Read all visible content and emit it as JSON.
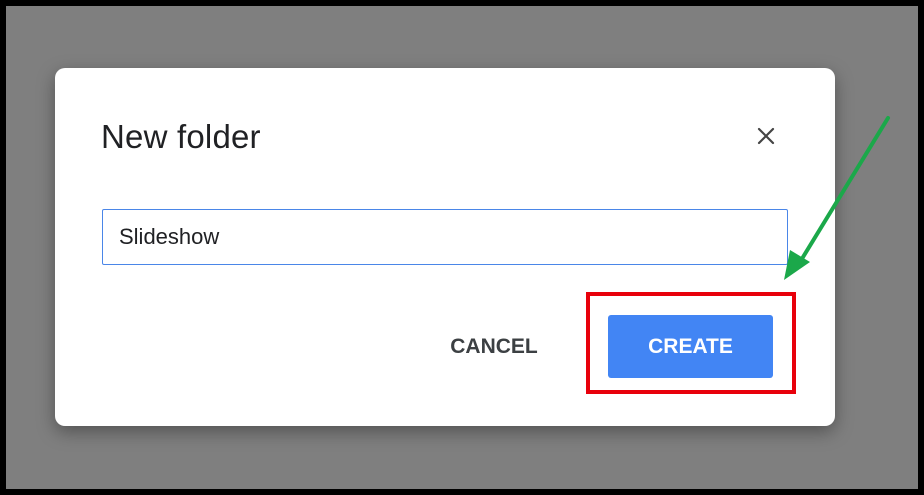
{
  "dialog": {
    "title": "New folder",
    "close_icon": "close-icon",
    "input_value": "Slideshow",
    "cancel_label": "CANCEL",
    "create_label": "CREATE"
  },
  "colors": {
    "backdrop": "#7f7f7f",
    "primary": "#4285f4",
    "annotation_box": "#e8000b",
    "annotation_arrow": "#1ba84a"
  }
}
